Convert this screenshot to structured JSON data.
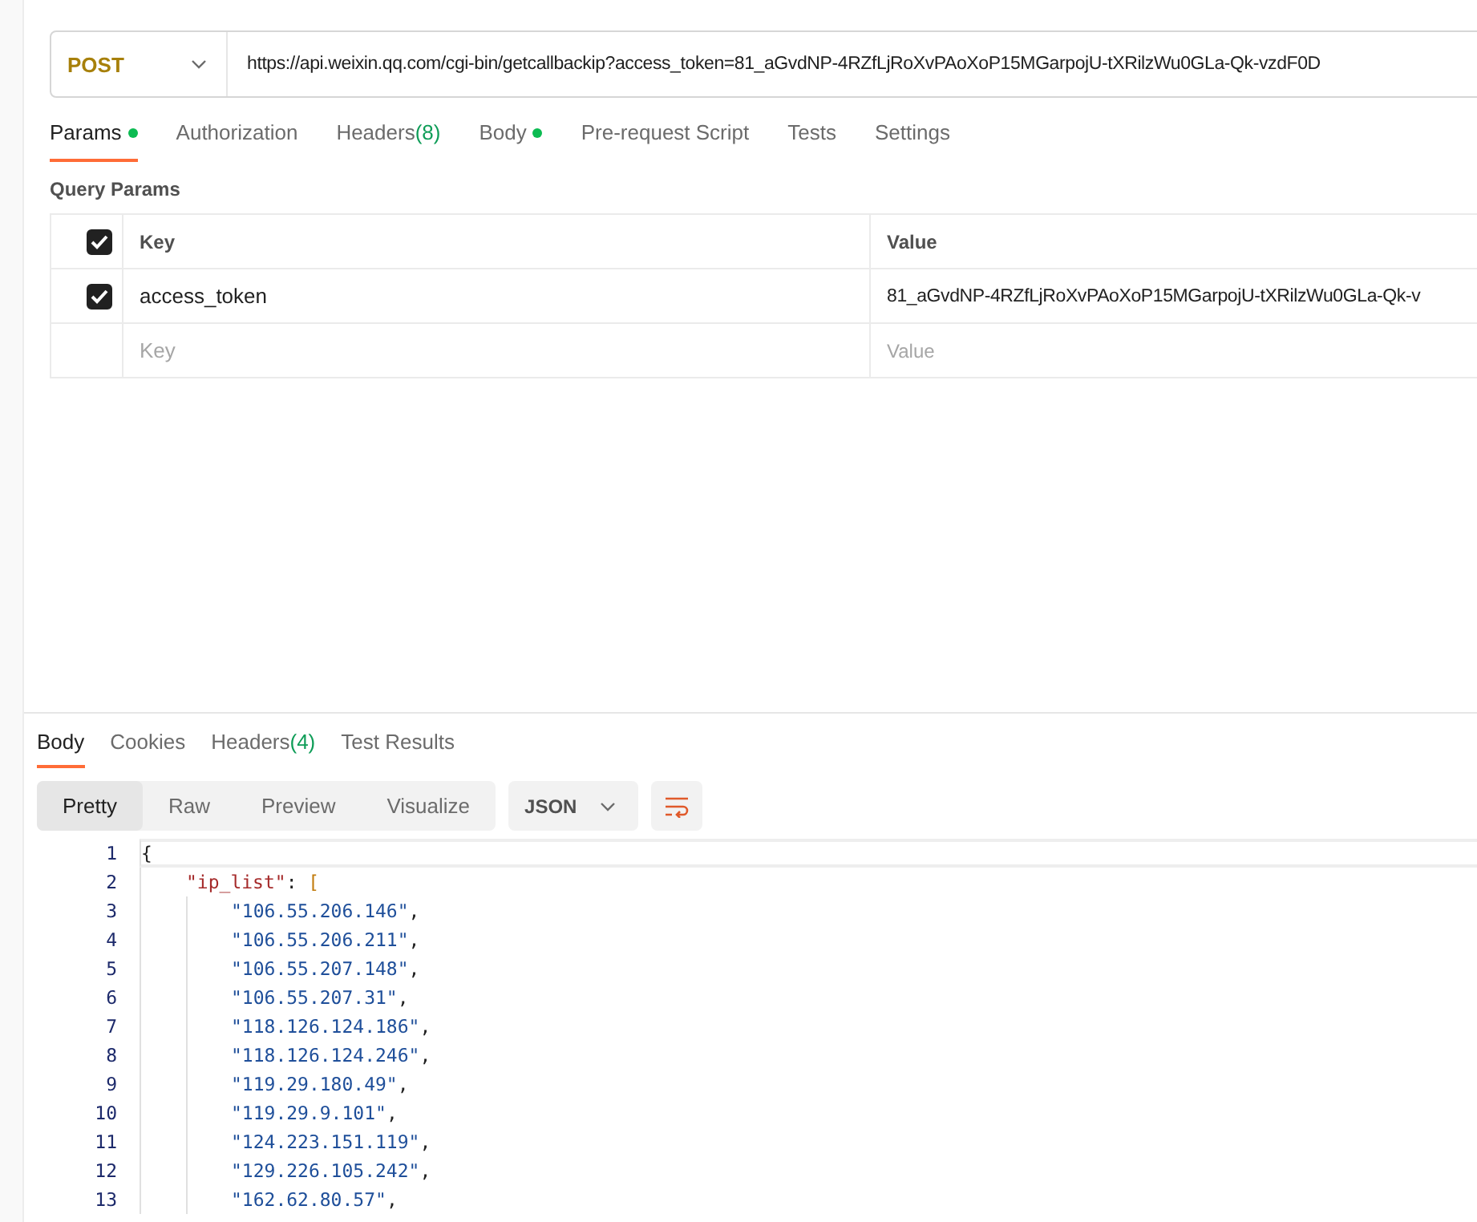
{
  "request": {
    "method": "POST",
    "url": "https://api.weixin.qq.com/cgi-bin/getcallbackip?access_token=81_aGvdNP-4RZfLjRoXvPAoXoP15MGarpojU-tXRilzWu0GLa-Qk-vzdF0D"
  },
  "request_tabs": [
    {
      "label": "Params",
      "dot": true,
      "selected": true
    },
    {
      "label": "Authorization",
      "dot": false,
      "selected": false
    },
    {
      "label": "Headers",
      "count": "(8)",
      "dot": false,
      "selected": false
    },
    {
      "label": "Body",
      "dot": true,
      "selected": false
    },
    {
      "label": "Pre-request Script",
      "dot": false,
      "selected": false
    },
    {
      "label": "Tests",
      "dot": false,
      "selected": false
    },
    {
      "label": "Settings",
      "dot": false,
      "selected": false
    }
  ],
  "query_params": {
    "title": "Query Params",
    "header": {
      "checked": true,
      "key": "Key",
      "value": "Value"
    },
    "rows": [
      {
        "checked": true,
        "key": "access_token",
        "value": "81_aGvdNP-4RZfLjRoXvPAoXoP15MGarpojU-tXRilzWu0GLa-Qk-v"
      }
    ],
    "new_row": {
      "key_placeholder": "Key",
      "value_placeholder": "Value"
    }
  },
  "response_tabs": [
    {
      "label": "Body",
      "selected": true
    },
    {
      "label": "Cookies",
      "selected": false
    },
    {
      "label": "Headers",
      "count": "(4)",
      "selected": false
    },
    {
      "label": "Test Results",
      "selected": false
    }
  ],
  "view_modes": [
    {
      "label": "Pretty",
      "selected": true
    },
    {
      "label": "Raw",
      "selected": false
    },
    {
      "label": "Preview",
      "selected": false
    },
    {
      "label": "Visualize",
      "selected": false
    }
  ],
  "format": "JSON",
  "code": [
    {
      "number": "1",
      "parts": [
        {
          "text": "{",
          "kind": "punct"
        }
      ]
    },
    {
      "number": "2",
      "parts": [
        {
          "text": "\"ip_list\"",
          "kind": "key"
        },
        {
          "text": ": ",
          "kind": "punct"
        },
        {
          "text": "[",
          "kind": "bracket"
        }
      ],
      "children": [
        {
          "number": "3",
          "parts": [
            {
              "text": "\"106.55.206.146\"",
              "kind": "string"
            },
            {
              "text": ",",
              "kind": "punct"
            }
          ]
        },
        {
          "number": "4",
          "parts": [
            {
              "text": "\"106.55.206.211\"",
              "kind": "string"
            },
            {
              "text": ",",
              "kind": "punct"
            }
          ]
        },
        {
          "number": "5",
          "parts": [
            {
              "text": "\"106.55.207.148\"",
              "kind": "string"
            },
            {
              "text": ",",
              "kind": "punct"
            }
          ]
        },
        {
          "number": "6",
          "parts": [
            {
              "text": "\"106.55.207.31\"",
              "kind": "string"
            },
            {
              "text": ",",
              "kind": "punct"
            }
          ]
        },
        {
          "number": "7",
          "parts": [
            {
              "text": "\"118.126.124.186\"",
              "kind": "string"
            },
            {
              "text": ",",
              "kind": "punct"
            }
          ]
        },
        {
          "number": "8",
          "parts": [
            {
              "text": "\"118.126.124.246\"",
              "kind": "string"
            },
            {
              "text": ",",
              "kind": "punct"
            }
          ]
        },
        {
          "number": "9",
          "parts": [
            {
              "text": "\"119.29.180.49\"",
              "kind": "string"
            },
            {
              "text": ",",
              "kind": "punct"
            }
          ]
        },
        {
          "number": "10",
          "parts": [
            {
              "text": "\"119.29.9.101\"",
              "kind": "string"
            },
            {
              "text": ",",
              "kind": "punct"
            }
          ]
        },
        {
          "number": "11",
          "parts": [
            {
              "text": "\"124.223.151.119\"",
              "kind": "string"
            },
            {
              "text": ",",
              "kind": "punct"
            }
          ]
        },
        {
          "number": "12",
          "parts": [
            {
              "text": "\"129.226.105.242\"",
              "kind": "string"
            },
            {
              "text": ",",
              "kind": "punct"
            }
          ]
        },
        {
          "number": "13",
          "parts": [
            {
              "text": "\"162.62.80.57\"",
              "kind": "string"
            },
            {
              "text": ",",
              "kind": "punct"
            }
          ]
        }
      ]
    }
  ]
}
